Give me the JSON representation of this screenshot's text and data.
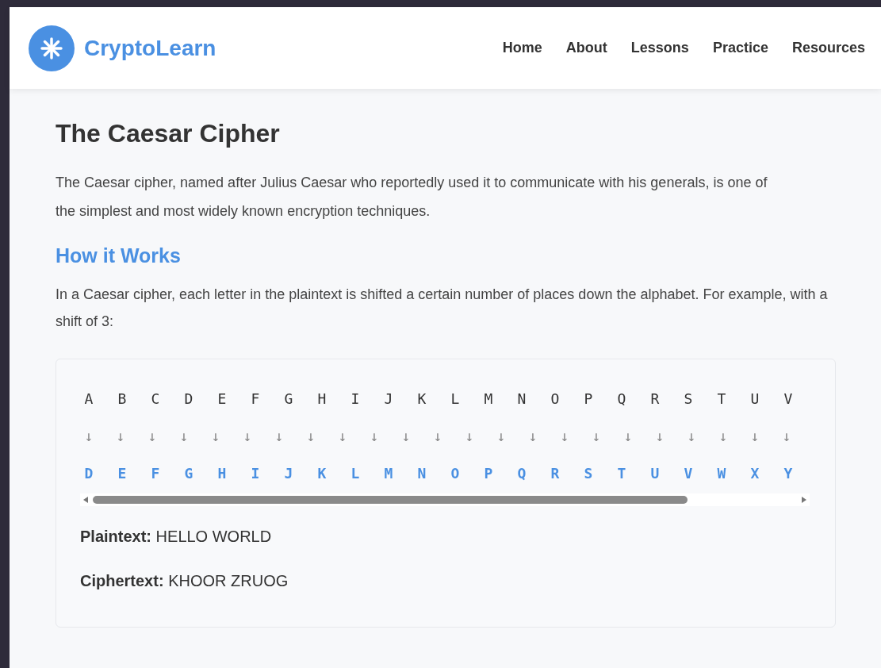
{
  "brand": {
    "name": "CryptoLearn"
  },
  "nav": [
    "Home",
    "About",
    "Lessons",
    "Practice",
    "Resources"
  ],
  "title": "The Caesar Cipher",
  "intro": "The Caesar cipher, named after Julius Caesar who reportedly used it to communicate with his generals, is one of the simplest and most widely known encryption techniques.",
  "section_heading": "How it Works",
  "section_text": "In a Caesar cipher, each letter in the plaintext is shifted a certain number of places down the alphabet. For example, with a shift of 3:",
  "demo": {
    "plain_letters": [
      "A",
      "B",
      "C",
      "D",
      "E",
      "F",
      "G",
      "H",
      "I",
      "J",
      "K",
      "L",
      "M",
      "N",
      "O",
      "P",
      "Q",
      "R",
      "S",
      "T",
      "U",
      "V"
    ],
    "arrows": [
      "↓",
      "↓",
      "↓",
      "↓",
      "↓",
      "↓",
      "↓",
      "↓",
      "↓",
      "↓",
      "↓",
      "↓",
      "↓",
      "↓",
      "↓",
      "↓",
      "↓",
      "↓",
      "↓",
      "↓",
      "↓",
      "↓",
      "↓"
    ],
    "cipher_letters": [
      "D",
      "E",
      "F",
      "G",
      "H",
      "I",
      "J",
      "K",
      "L",
      "M",
      "N",
      "O",
      "P",
      "Q",
      "R",
      "S",
      "T",
      "U",
      "V",
      "W",
      "X",
      "Y"
    ],
    "examples": [
      {
        "label": "Plaintext:",
        "value": "HELLO WORLD"
      },
      {
        "label": "Ciphertext:",
        "value": "KHOOR ZRUOG"
      }
    ]
  }
}
